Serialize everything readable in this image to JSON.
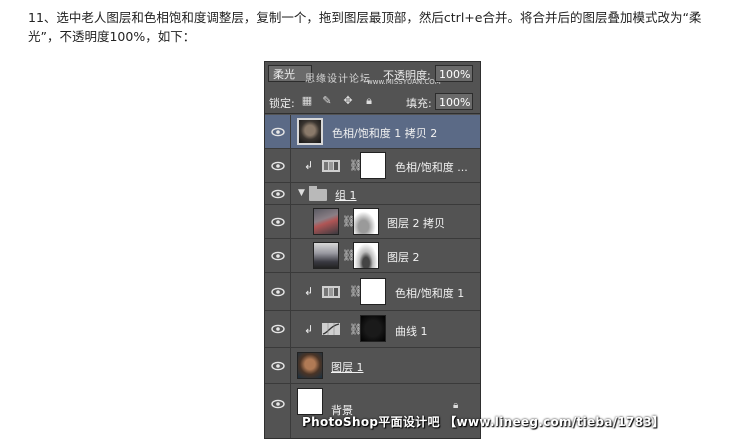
{
  "instruction": "11、选中老人图层和色相饱和度调整层，复制一个，拖到图层最顶部，然后ctrl+e合并。将合并后的图层叠加模式改为“柔光”，不透明度100%，如下：",
  "panel": {
    "blend_mode": "柔光",
    "opacity_label": "不透明度:",
    "opacity_value": "100%",
    "lock_label": "锁定:",
    "fill_label": "填充:",
    "fill_value": "100%",
    "watermark_top": "思缘设计论坛",
    "watermark_url": "www.MISSYUAN.COM"
  },
  "layers": [
    {
      "name": "色相/饱和度 1 拷贝 2",
      "selected": true
    },
    {
      "name": "色相/饱和度 ..."
    },
    {
      "name": "组 1"
    },
    {
      "name": "图层 2 拷贝"
    },
    {
      "name": "图层 2"
    },
    {
      "name": "色相/饱和度 1"
    },
    {
      "name": "曲线 1"
    },
    {
      "name": "图层 1"
    },
    {
      "name": "背景"
    }
  ],
  "footer_watermark": "PhotoShop平面设计吧 【www.lineeg.com/tieba/1783】",
  "colors": {
    "panel_bg": "#535353",
    "selected_bg": "#5b6a86"
  }
}
